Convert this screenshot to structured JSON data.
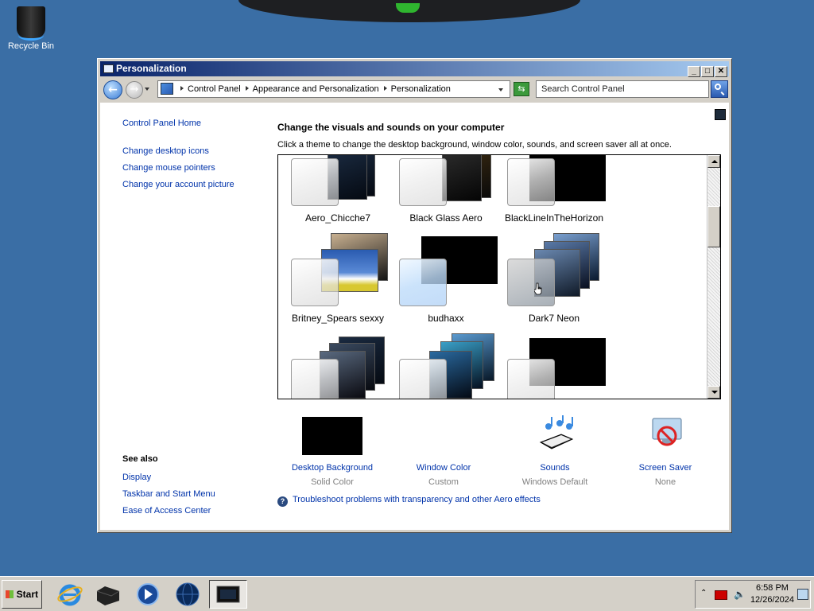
{
  "desktop": {
    "recycle_bin_label": "Recycle Bin"
  },
  "window": {
    "title": "Personalization",
    "address": {
      "crumbs": [
        "Control Panel",
        "Appearance and Personalization",
        "Personalization"
      ]
    },
    "search_placeholder": "Search Control Panel"
  },
  "sidebar": {
    "home": "Control Panel Home",
    "links": [
      "Change desktop icons",
      "Change mouse pointers",
      "Change your account picture"
    ],
    "see_also_heading": "See also",
    "see_also": [
      "Display",
      "Taskbar and Start Menu",
      "Ease of Access Center"
    ]
  },
  "main": {
    "heading": "Change the visuals and sounds on your computer",
    "subheading": "Click a theme to change the desktop background, window color, sounds, and screen saver all at once.",
    "themes": [
      {
        "name": "Aero_Chicche7"
      },
      {
        "name": "Black Glass Aero"
      },
      {
        "name": "BlackLineInTheHorizon"
      },
      {
        "name": "Britney_Spears sexxy"
      },
      {
        "name": "budhaxx"
      },
      {
        "name": "Dark7 Neon"
      }
    ],
    "settings": [
      {
        "name": "Desktop Background",
        "value": "Solid Color"
      },
      {
        "name": "Window Color",
        "value": "Custom"
      },
      {
        "name": "Sounds",
        "value": "Windows Default"
      },
      {
        "name": "Screen Saver",
        "value": "None"
      }
    ],
    "troubleshoot": "Troubleshoot problems with transparency and other Aero effects"
  },
  "taskbar": {
    "start_label": "Start",
    "time": "6:58 PM",
    "date": "12/26/2024"
  },
  "colors": {
    "desktop": "#3a6ea5",
    "link": "#0033aa",
    "titlebar_start": "#0a246a",
    "titlebar_end": "#a6caf0"
  }
}
